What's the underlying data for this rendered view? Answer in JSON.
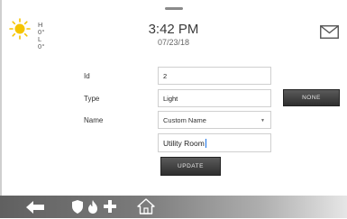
{
  "weather": {
    "high_label": "H 0°",
    "low_label": "L 0°",
    "icon": "sun-icon"
  },
  "clock": {
    "time": "3:42 PM",
    "date": "07/23/18"
  },
  "header": {
    "mail_icon": "mail-icon"
  },
  "form": {
    "id_label": "Id",
    "id_value": "2",
    "type_label": "Type",
    "type_value": "Light",
    "name_label": "Name",
    "name_select_value": "Custom Name",
    "name_text_value": "Utility Room",
    "update_label": "UPDATE",
    "none_label": "NONE"
  },
  "bottom_bar": {
    "icons": [
      "back-arrow-icon",
      "shield-icon",
      "fire-icon",
      "medical-cross-icon",
      "home-icon"
    ]
  },
  "colors": {
    "sun": "#f5c400",
    "bar_dark": "#606060",
    "button": "#3c3c3c",
    "cursor": "#1a73e8"
  }
}
